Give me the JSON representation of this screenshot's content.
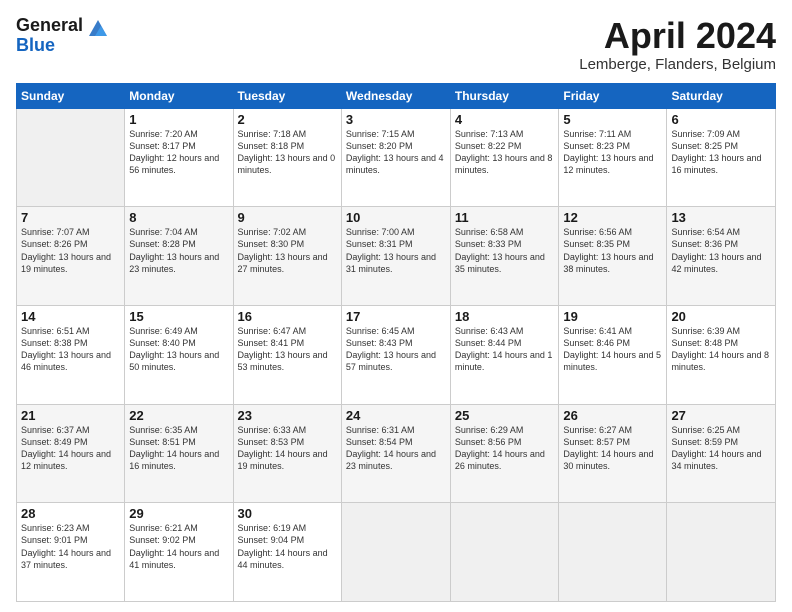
{
  "header": {
    "logo_general": "General",
    "logo_blue": "Blue",
    "month_title": "April 2024",
    "location": "Lemberge, Flanders, Belgium"
  },
  "days_of_week": [
    "Sunday",
    "Monday",
    "Tuesday",
    "Wednesday",
    "Thursday",
    "Friday",
    "Saturday"
  ],
  "weeks": [
    [
      {
        "day": "",
        "sunrise": "",
        "sunset": "",
        "daylight": ""
      },
      {
        "day": "1",
        "sunrise": "Sunrise: 7:20 AM",
        "sunset": "Sunset: 8:17 PM",
        "daylight": "Daylight: 12 hours and 56 minutes."
      },
      {
        "day": "2",
        "sunrise": "Sunrise: 7:18 AM",
        "sunset": "Sunset: 8:18 PM",
        "daylight": "Daylight: 13 hours and 0 minutes."
      },
      {
        "day": "3",
        "sunrise": "Sunrise: 7:15 AM",
        "sunset": "Sunset: 8:20 PM",
        "daylight": "Daylight: 13 hours and 4 minutes."
      },
      {
        "day": "4",
        "sunrise": "Sunrise: 7:13 AM",
        "sunset": "Sunset: 8:22 PM",
        "daylight": "Daylight: 13 hours and 8 minutes."
      },
      {
        "day": "5",
        "sunrise": "Sunrise: 7:11 AM",
        "sunset": "Sunset: 8:23 PM",
        "daylight": "Daylight: 13 hours and 12 minutes."
      },
      {
        "day": "6",
        "sunrise": "Sunrise: 7:09 AM",
        "sunset": "Sunset: 8:25 PM",
        "daylight": "Daylight: 13 hours and 16 minutes."
      }
    ],
    [
      {
        "day": "7",
        "sunrise": "Sunrise: 7:07 AM",
        "sunset": "Sunset: 8:26 PM",
        "daylight": "Daylight: 13 hours and 19 minutes."
      },
      {
        "day": "8",
        "sunrise": "Sunrise: 7:04 AM",
        "sunset": "Sunset: 8:28 PM",
        "daylight": "Daylight: 13 hours and 23 minutes."
      },
      {
        "day": "9",
        "sunrise": "Sunrise: 7:02 AM",
        "sunset": "Sunset: 8:30 PM",
        "daylight": "Daylight: 13 hours and 27 minutes."
      },
      {
        "day": "10",
        "sunrise": "Sunrise: 7:00 AM",
        "sunset": "Sunset: 8:31 PM",
        "daylight": "Daylight: 13 hours and 31 minutes."
      },
      {
        "day": "11",
        "sunrise": "Sunrise: 6:58 AM",
        "sunset": "Sunset: 8:33 PM",
        "daylight": "Daylight: 13 hours and 35 minutes."
      },
      {
        "day": "12",
        "sunrise": "Sunrise: 6:56 AM",
        "sunset": "Sunset: 8:35 PM",
        "daylight": "Daylight: 13 hours and 38 minutes."
      },
      {
        "day": "13",
        "sunrise": "Sunrise: 6:54 AM",
        "sunset": "Sunset: 8:36 PM",
        "daylight": "Daylight: 13 hours and 42 minutes."
      }
    ],
    [
      {
        "day": "14",
        "sunrise": "Sunrise: 6:51 AM",
        "sunset": "Sunset: 8:38 PM",
        "daylight": "Daylight: 13 hours and 46 minutes."
      },
      {
        "day": "15",
        "sunrise": "Sunrise: 6:49 AM",
        "sunset": "Sunset: 8:40 PM",
        "daylight": "Daylight: 13 hours and 50 minutes."
      },
      {
        "day": "16",
        "sunrise": "Sunrise: 6:47 AM",
        "sunset": "Sunset: 8:41 PM",
        "daylight": "Daylight: 13 hours and 53 minutes."
      },
      {
        "day": "17",
        "sunrise": "Sunrise: 6:45 AM",
        "sunset": "Sunset: 8:43 PM",
        "daylight": "Daylight: 13 hours and 57 minutes."
      },
      {
        "day": "18",
        "sunrise": "Sunrise: 6:43 AM",
        "sunset": "Sunset: 8:44 PM",
        "daylight": "Daylight: 14 hours and 1 minute."
      },
      {
        "day": "19",
        "sunrise": "Sunrise: 6:41 AM",
        "sunset": "Sunset: 8:46 PM",
        "daylight": "Daylight: 14 hours and 5 minutes."
      },
      {
        "day": "20",
        "sunrise": "Sunrise: 6:39 AM",
        "sunset": "Sunset: 8:48 PM",
        "daylight": "Daylight: 14 hours and 8 minutes."
      }
    ],
    [
      {
        "day": "21",
        "sunrise": "Sunrise: 6:37 AM",
        "sunset": "Sunset: 8:49 PM",
        "daylight": "Daylight: 14 hours and 12 minutes."
      },
      {
        "day": "22",
        "sunrise": "Sunrise: 6:35 AM",
        "sunset": "Sunset: 8:51 PM",
        "daylight": "Daylight: 14 hours and 16 minutes."
      },
      {
        "day": "23",
        "sunrise": "Sunrise: 6:33 AM",
        "sunset": "Sunset: 8:53 PM",
        "daylight": "Daylight: 14 hours and 19 minutes."
      },
      {
        "day": "24",
        "sunrise": "Sunrise: 6:31 AM",
        "sunset": "Sunset: 8:54 PM",
        "daylight": "Daylight: 14 hours and 23 minutes."
      },
      {
        "day": "25",
        "sunrise": "Sunrise: 6:29 AM",
        "sunset": "Sunset: 8:56 PM",
        "daylight": "Daylight: 14 hours and 26 minutes."
      },
      {
        "day": "26",
        "sunrise": "Sunrise: 6:27 AM",
        "sunset": "Sunset: 8:57 PM",
        "daylight": "Daylight: 14 hours and 30 minutes."
      },
      {
        "day": "27",
        "sunrise": "Sunrise: 6:25 AM",
        "sunset": "Sunset: 8:59 PM",
        "daylight": "Daylight: 14 hours and 34 minutes."
      }
    ],
    [
      {
        "day": "28",
        "sunrise": "Sunrise: 6:23 AM",
        "sunset": "Sunset: 9:01 PM",
        "daylight": "Daylight: 14 hours and 37 minutes."
      },
      {
        "day": "29",
        "sunrise": "Sunrise: 6:21 AM",
        "sunset": "Sunset: 9:02 PM",
        "daylight": "Daylight: 14 hours and 41 minutes."
      },
      {
        "day": "30",
        "sunrise": "Sunrise: 6:19 AM",
        "sunset": "Sunset: 9:04 PM",
        "daylight": "Daylight: 14 hours and 44 minutes."
      },
      {
        "day": "",
        "sunrise": "",
        "sunset": "",
        "daylight": ""
      },
      {
        "day": "",
        "sunrise": "",
        "sunset": "",
        "daylight": ""
      },
      {
        "day": "",
        "sunrise": "",
        "sunset": "",
        "daylight": ""
      },
      {
        "day": "",
        "sunrise": "",
        "sunset": "",
        "daylight": ""
      }
    ]
  ]
}
